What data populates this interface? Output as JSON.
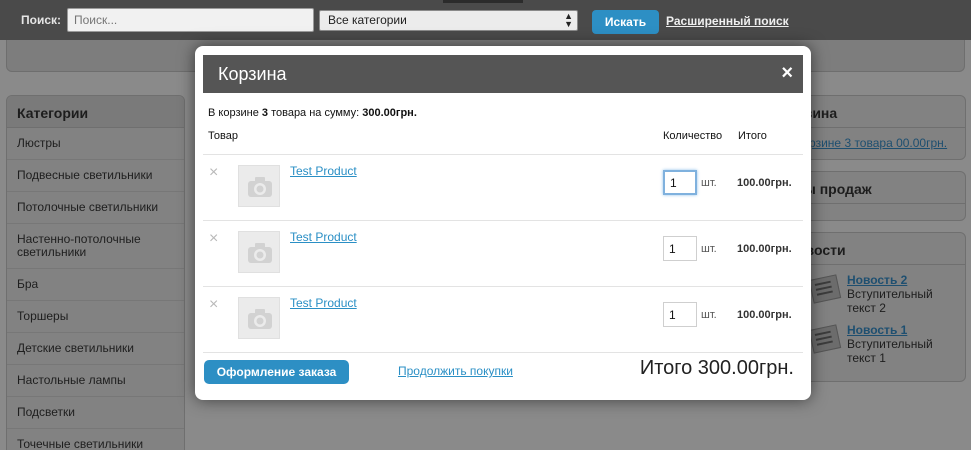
{
  "header": {
    "search_label": "Поиск:",
    "search_placeholder": "Поиск...",
    "category_select": "Все категории",
    "search_button": "Искать",
    "advanced_search": "Расширенный поиск"
  },
  "sidebar": {
    "title": "Категории",
    "items": [
      "Люстры",
      "Подвесные светильники",
      "Потолочные светильники",
      "Настенно-потолочные светильники",
      "Бра",
      "Торшеры",
      "Детские светильники",
      "Настольные лампы",
      "Подсветки",
      "Точечные светильники"
    ]
  },
  "right": {
    "cart_title": "рзина",
    "cart_text": "корзине 3 товара 00.00грн.",
    "bestsellers_title": "ты продаж",
    "news_title": "овости",
    "news": [
      {
        "title": "Новость 2",
        "text": "Вступительный текст 2"
      },
      {
        "title": "Новость 1",
        "text": "Вступительный текст 1"
      }
    ]
  },
  "modal": {
    "title": "Корзина",
    "close": "×",
    "summary_prefix": "В корзине ",
    "summary_count": "3",
    "summary_middle": " товара на сумму: ",
    "summary_sum": "300.00грн.",
    "col_product": "Товар",
    "col_qty": "Количество",
    "col_total": "Итого",
    "items": [
      {
        "name": "Test Product",
        "qty": "1",
        "unit": "шт.",
        "total": "100.00грн."
      },
      {
        "name": "Test Product",
        "qty": "1",
        "unit": "шт.",
        "total": "100.00грн."
      },
      {
        "name": "Test Product",
        "qty": "1",
        "unit": "шт.",
        "total": "100.00грн."
      }
    ],
    "remove_icon": "×",
    "checkout_button": "Оформление заказа",
    "continue_link": "Продолжить покупки",
    "grand_total": "Итого 300.00грн."
  }
}
